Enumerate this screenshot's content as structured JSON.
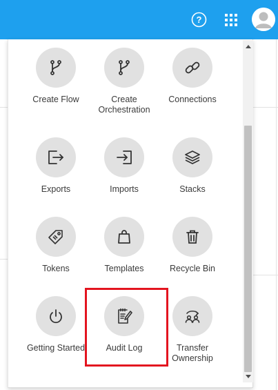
{
  "header": {
    "help_icon": "help-circle-icon",
    "apps_icon": "apps-grid-icon",
    "avatar_icon": "user-avatar-icon",
    "color": "#1ea0ee"
  },
  "menu": {
    "items": [
      {
        "label": "Create Flow",
        "icon": "flow-branch-icon"
      },
      {
        "label": "Create\nOrchestration",
        "icon": "orchestration-branch-icon"
      },
      {
        "label": "Connections",
        "icon": "chain-link-icon"
      },
      {
        "label": "Exports",
        "icon": "export-icon"
      },
      {
        "label": "Imports",
        "icon": "import-icon"
      },
      {
        "label": "Stacks",
        "icon": "layers-icon"
      },
      {
        "label": "Tokens",
        "icon": "tag-icon"
      },
      {
        "label": "Templates",
        "icon": "shopping-bag-icon"
      },
      {
        "label": "Recycle Bin",
        "icon": "trash-icon"
      },
      {
        "label": "Getting Started",
        "icon": "power-icon"
      },
      {
        "label": "Audit Log",
        "icon": "clipboard-edit-icon"
      },
      {
        "label": "Transfer\nOwnership",
        "icon": "transfer-users-icon"
      }
    ],
    "highlighted_item": "Audit Log",
    "highlight_color": "#e3141f"
  }
}
